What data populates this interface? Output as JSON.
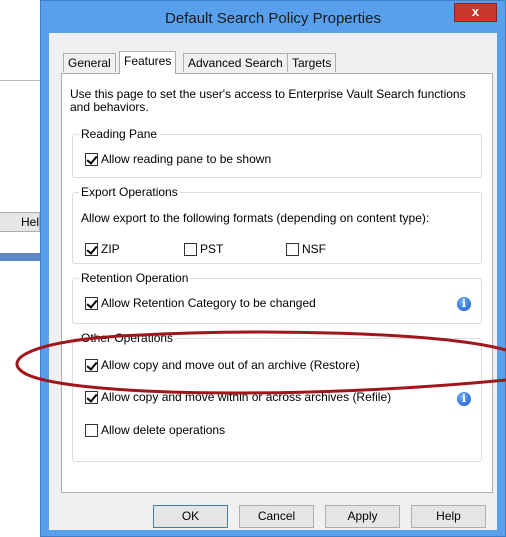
{
  "background_window": {
    "button_label": "Hel"
  },
  "dialog": {
    "title": "Default Search Policy Properties",
    "close_label": "x",
    "tabs": [
      {
        "label": "General"
      },
      {
        "label": "Features"
      },
      {
        "label": "Advanced Search"
      },
      {
        "label": "Targets"
      }
    ],
    "active_tab": "Features",
    "intro": "Use this page to set the user's access to Enterprise Vault Search functions and behaviors.",
    "groups": {
      "reading_pane": {
        "label": "Reading Pane",
        "option": {
          "label": "Allow reading pane to be shown",
          "checked": true
        }
      },
      "export": {
        "label": "Export Operations",
        "description": "Allow export to the following formats (depending on content type):",
        "formats": [
          {
            "label": "ZIP",
            "checked": true
          },
          {
            "label": "PST",
            "checked": false
          },
          {
            "label": "NSF",
            "checked": false
          }
        ]
      },
      "retention": {
        "label": "Retention Operation",
        "option": {
          "label": "Allow Retention Category to be changed",
          "checked": true
        }
      },
      "other": {
        "label": "Other Operations",
        "options": [
          {
            "label": "Allow copy and move out of an archive (Restore)",
            "checked": true
          },
          {
            "label": "Allow copy and move within or across archives (Refile)",
            "checked": true
          },
          {
            "label": "Allow delete operations",
            "checked": false
          }
        ]
      }
    },
    "buttons": {
      "ok": "OK",
      "cancel": "Cancel",
      "apply": "Apply",
      "help": "Help"
    }
  },
  "colors": {
    "frame": "#59a0ec",
    "close": "#c7382b",
    "annotation": "#a0161a",
    "info": "#1557c4"
  }
}
